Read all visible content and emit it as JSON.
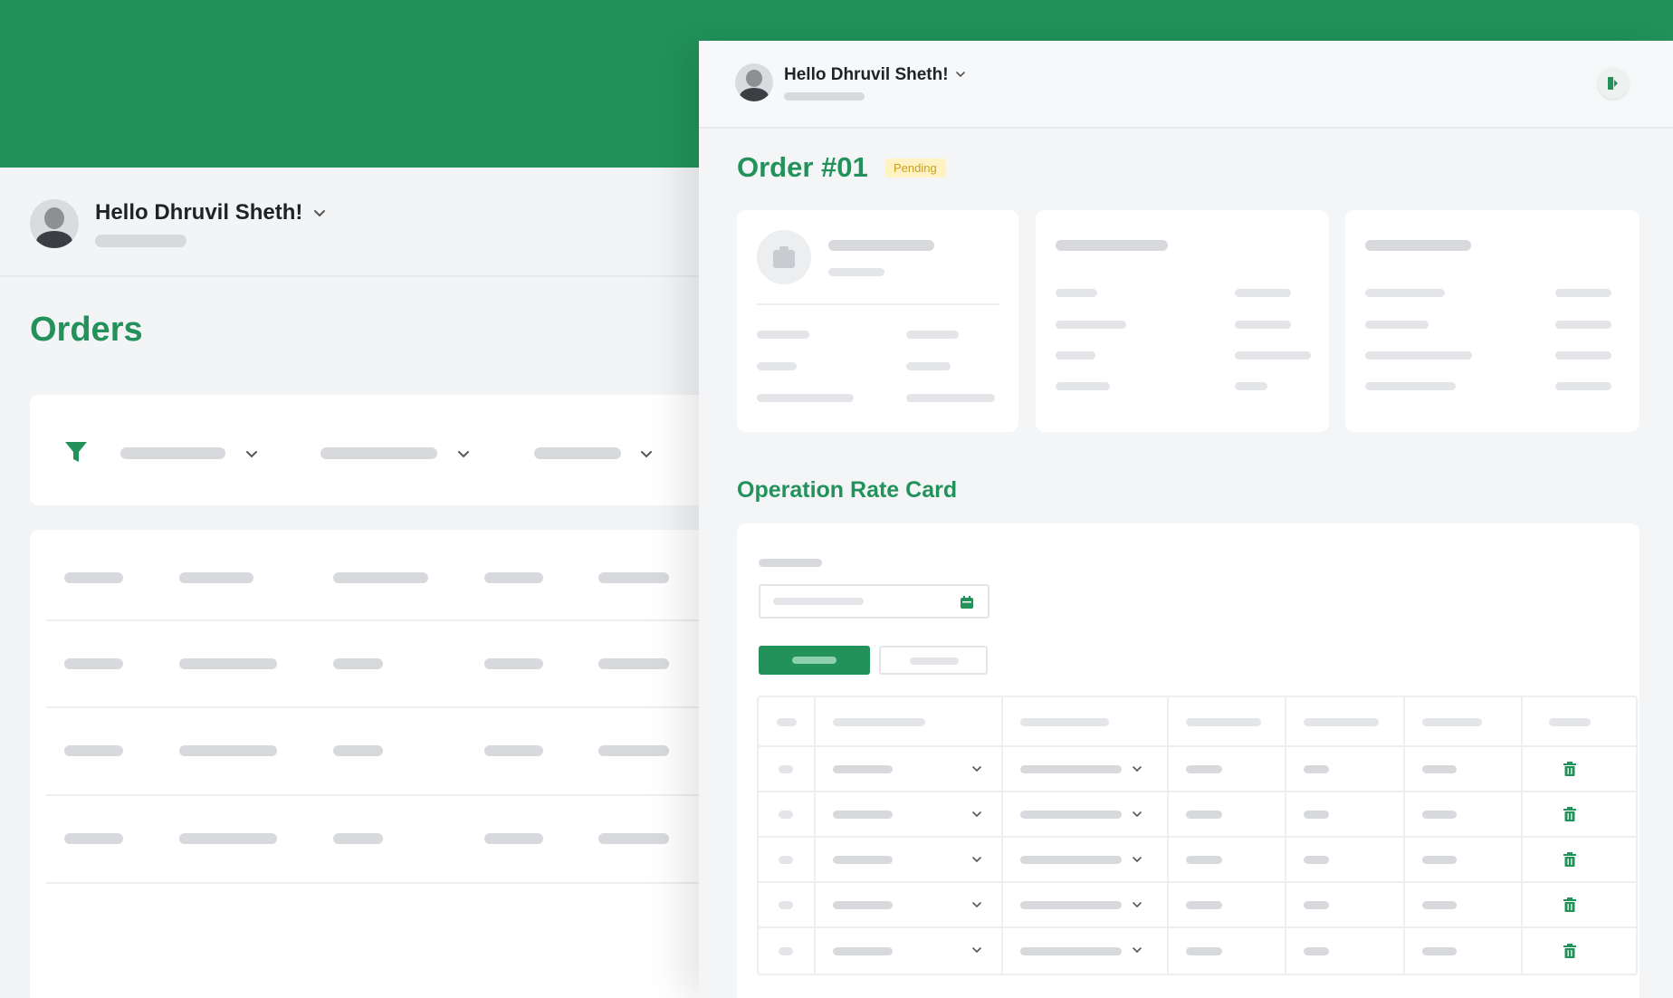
{
  "app": {
    "colors": {
      "brand": "#22925a",
      "pending_bg": "#fff3c4",
      "pending_text": "#c8a020"
    }
  },
  "orders_window": {
    "header": {
      "greeting": "Hello Dhruvil Sheth!",
      "avatar_icon": "user-avatar",
      "dropdown_icon": "chevron-down-icon"
    },
    "page_title": "Orders",
    "filter_bar": {
      "icon": "filter-icon",
      "dropdown_count": 3
    },
    "table_rows": 4
  },
  "order_window": {
    "header": {
      "greeting": "Hello Dhruvil Sheth!",
      "avatar_icon": "user-avatar",
      "logout_icon": "logout-icon"
    },
    "order_title": "Order #01",
    "status_badge": "Pending",
    "section_title": "Operation Rate Card",
    "rate_table_rows": 5
  }
}
